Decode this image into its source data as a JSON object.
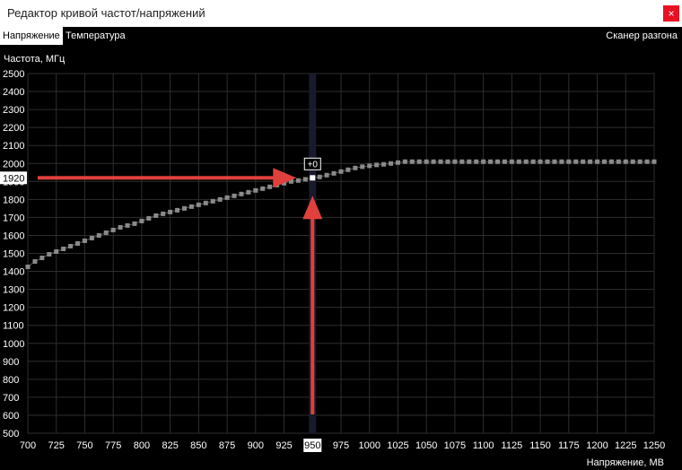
{
  "window": {
    "title": "Редактор кривой частот/напряжений",
    "close_glyph": "×"
  },
  "tabs": [
    {
      "label": "Напряжение",
      "active": true
    },
    {
      "label": "Температура",
      "active": false
    }
  ],
  "scanner_label": "Сканер разгона",
  "colors": {
    "background": "#000000",
    "grid": "#2e2e2e",
    "curve_point": "#8a8a8a",
    "arrow": "#e0403c",
    "selected_column": "#1a1a2e"
  },
  "chart_data": {
    "type": "line",
    "ylabel": "Частота, МГц",
    "xlabel": "Напряжение, МВ",
    "xlim": [
      700,
      1250
    ],
    "ylim": [
      500,
      2500
    ],
    "x_ticks": [
      700,
      725,
      750,
      775,
      800,
      825,
      850,
      875,
      900,
      925,
      950,
      975,
      1000,
      1025,
      1050,
      1075,
      1100,
      1125,
      1150,
      1175,
      1200,
      1225,
      1250
    ],
    "y_ticks": [
      500,
      600,
      700,
      800,
      900,
      1000,
      1100,
      1200,
      1300,
      1400,
      1500,
      1600,
      1700,
      1800,
      1900,
      2000,
      2100,
      2200,
      2300,
      2400,
      2500
    ],
    "grid": true,
    "selected": {
      "voltage": 950,
      "frequency": 1920,
      "offset_label": "+0",
      "frequency_label": "1920",
      "voltage_label": "950"
    },
    "series": [
      {
        "x": [
          700,
          706.25,
          712.5,
          718.75,
          725,
          731.25,
          737.5,
          743.75,
          750,
          756.25,
          762.5,
          768.75,
          775,
          781.25,
          787.5,
          793.75,
          800,
          806.25,
          812.5,
          818.75,
          825,
          831.25,
          837.5,
          843.75,
          850,
          856.25,
          862.5,
          868.75,
          875,
          881.25,
          887.5,
          893.75,
          900,
          906.25,
          912.5,
          918.75,
          925,
          931.25,
          937.5,
          943.75,
          950,
          956.25,
          962.5,
          968.75,
          975,
          981.25,
          987.5,
          993.75,
          1000,
          1006.25,
          1012.5,
          1018.75,
          1025,
          1031.25,
          1037.5,
          1043.75,
          1050,
          1056.25,
          1062.5,
          1068.75,
          1075,
          1081.25,
          1087.5,
          1093.75,
          1100,
          1106.25,
          1112.5,
          1118.75,
          1125,
          1131.25,
          1137.5,
          1143.75,
          1150,
          1156.25,
          1162.5,
          1168.75,
          1175,
          1181.25,
          1187.5,
          1193.75,
          1200,
          1206.25,
          1212.5,
          1218.75,
          1225,
          1231.25,
          1237.5,
          1243.75,
          1250
        ],
        "y": [
          1425,
          1455,
          1475,
          1495,
          1510,
          1525,
          1540,
          1555,
          1570,
          1585,
          1600,
          1615,
          1630,
          1645,
          1655,
          1665,
          1680,
          1695,
          1710,
          1720,
          1730,
          1740,
          1750,
          1760,
          1770,
          1780,
          1790,
          1800,
          1810,
          1820,
          1830,
          1840,
          1850,
          1860,
          1870,
          1880,
          1890,
          1900,
          1905,
          1912,
          1920,
          1925,
          1935,
          1945,
          1955,
          1965,
          1975,
          1982,
          1987,
          1992,
          1995,
          2000,
          2005,
          2010,
          2010,
          2010,
          2010,
          2010,
          2010,
          2010,
          2010,
          2010,
          2010,
          2010,
          2010,
          2010,
          2010,
          2010,
          2010,
          2010,
          2010,
          2010,
          2010,
          2010,
          2010,
          2010,
          2010,
          2010,
          2010,
          2010,
          2010,
          2010,
          2010,
          2010,
          2010,
          2010,
          2010,
          2010,
          2010
        ]
      }
    ]
  }
}
